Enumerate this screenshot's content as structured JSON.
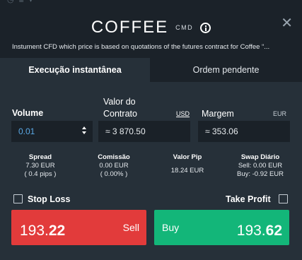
{
  "header": {
    "title": "COFFEE",
    "type_badge": "CMD",
    "description": "Instument CFD which price is based on quotations of the futures contract for Coffee “..."
  },
  "tabs": [
    {
      "label": "Execução instantânea",
      "active": true
    },
    {
      "label": "Ordem pendente",
      "active": false
    }
  ],
  "volume": {
    "label": "Volume",
    "value": "0.01"
  },
  "contract_value": {
    "label_line1": "Valor do",
    "label_line2": "Contrato",
    "currency": "USD",
    "value": "≈ 3 870.50"
  },
  "margin": {
    "label": "Margem",
    "currency": "EUR",
    "value": "≈ 353.06"
  },
  "stats": {
    "spread": {
      "label": "Spread",
      "line1": "7.30 EUR",
      "line2": "( 0.4 pips )"
    },
    "commission": {
      "label": "Comissão",
      "line1": "0.00 EUR",
      "line2": "( 0.00% )"
    },
    "pip_value": {
      "label": "Valor Pip",
      "line1": "18.24 EUR"
    },
    "swap": {
      "label": "Swap Diário",
      "line1": "Sell: 0.00 EUR",
      "line2": "Buy: -0.92 EUR"
    }
  },
  "stop_loss": {
    "label": "Stop Loss",
    "checked": false
  },
  "take_profit": {
    "label": "Take Profit",
    "checked": false
  },
  "sell": {
    "label": "Sell",
    "price_main": "193.",
    "price_big": "22"
  },
  "buy": {
    "label": "Buy",
    "price_main": "193.",
    "price_big": "62"
  },
  "colors": {
    "sell": "#e23b3b",
    "buy": "#13b679",
    "panel": "#263039",
    "background": "#1b2229",
    "volume_text": "#5aa9e6"
  }
}
